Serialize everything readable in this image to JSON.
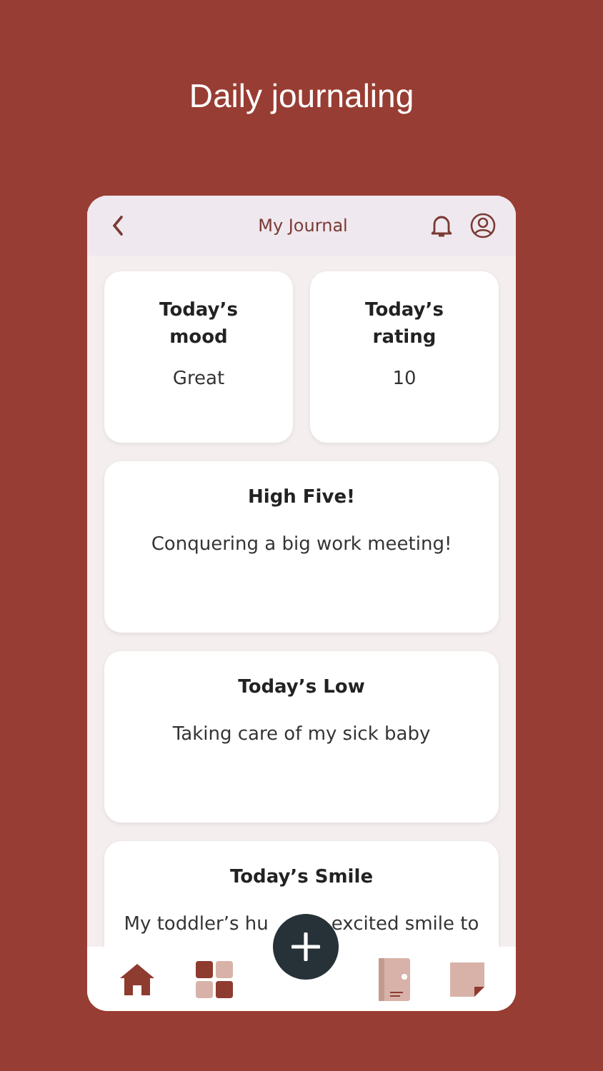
{
  "headline": "Daily journaling",
  "header": {
    "title": "My Journal"
  },
  "stats": [
    {
      "label": "Today’s mood",
      "value": "Great"
    },
    {
      "label": "Today’s rating",
      "value": "10"
    }
  ],
  "entries": [
    {
      "title": "High Five!",
      "lines": [
        [
          "Conquering a big work meeting!"
        ]
      ]
    },
    {
      "title": "Today’s Low",
      "lines": [
        [
          "Taking care of my sick baby"
        ]
      ]
    },
    {
      "title": "Today’s Smile",
      "lines": [
        [
          "My toddler’s hu",
          "excited smile to"
        ]
      ]
    }
  ],
  "nav": [
    {
      "kind": "home",
      "selected": true
    },
    {
      "kind": "grid",
      "selected": false
    },
    {
      "kind": "add",
      "selected": false
    },
    {
      "kind": "book",
      "selected": false
    },
    {
      "kind": "note",
      "selected": false
    }
  ]
}
